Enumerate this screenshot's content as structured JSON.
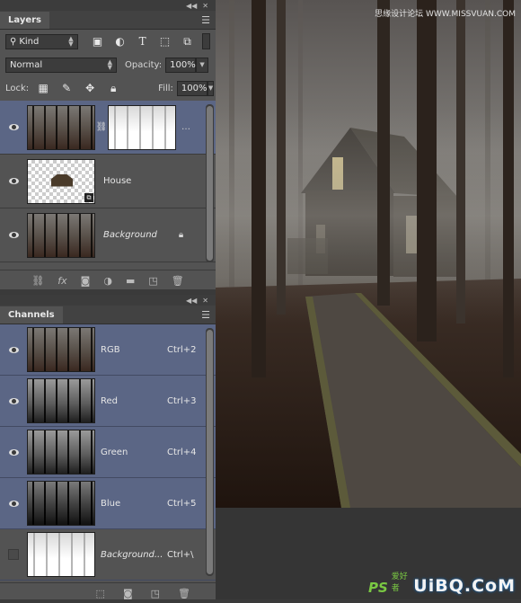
{
  "layers_panel": {
    "title": "Layers",
    "filter_kind": "Kind",
    "blend_mode": "Normal",
    "opacity_label": "Opacity:",
    "opacity_value": "100%",
    "lock_label": "Lock:",
    "fill_label": "Fill:",
    "fill_value": "100%",
    "layers": [
      {
        "name": "",
        "thumb": "forest",
        "has_mask": true,
        "selected": true
      },
      {
        "name": "House",
        "thumb": "house",
        "has_mask": false,
        "selected": false
      },
      {
        "name": "Background",
        "thumb": "forest",
        "locked": true,
        "selected": false
      }
    ]
  },
  "channels_panel": {
    "title": "Channels",
    "channels": [
      {
        "name": "RGB",
        "shortcut": "Ctrl+2",
        "visible": true
      },
      {
        "name": "Red",
        "shortcut": "Ctrl+3",
        "visible": true
      },
      {
        "name": "Green",
        "shortcut": "Ctrl+4",
        "visible": true
      },
      {
        "name": "Blue",
        "shortcut": "Ctrl+5",
        "visible": true
      },
      {
        "name": "Background...",
        "shortcut": "Ctrl+\\",
        "visible": false
      }
    ]
  },
  "canvas": {
    "watermark": "思缘设计论坛 WWW.MISSVUAN.COM",
    "logo_ps": "PS",
    "logo_cn": "爱好者",
    "logo_main": "UiBQ.CoM"
  },
  "colors": {
    "panel_bg": "#535353",
    "selected_row": "#5b6685",
    "logo_accent": "#7ac943"
  }
}
